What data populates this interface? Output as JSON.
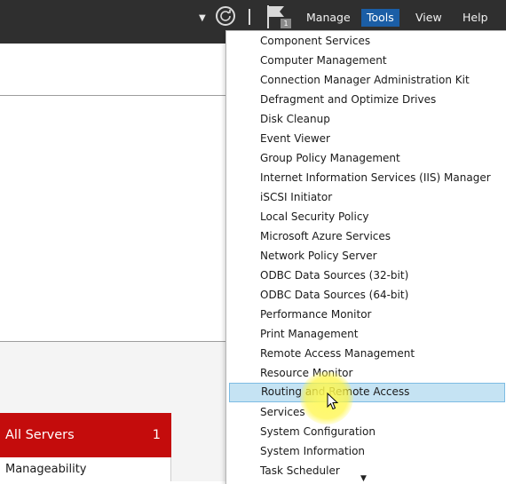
{
  "toolbar": {
    "notification_count": "1",
    "menus": [
      "Manage",
      "Tools",
      "View",
      "Help"
    ],
    "active_menu": "Tools"
  },
  "tools_menu": {
    "items": [
      "Component Services",
      "Computer Management",
      "Connection Manager Administration Kit",
      "Defragment and Optimize Drives",
      "Disk Cleanup",
      "Event Viewer",
      "Group Policy Management",
      "Internet Information Services (IIS) Manager",
      "iSCSI Initiator",
      "Local Security Policy",
      "Microsoft Azure Services",
      "Network Policy Server",
      "ODBC Data Sources (32-bit)",
      "ODBC Data Sources (64-bit)",
      "Performance Monitor",
      "Print Management",
      "Remote Access Management",
      "Resource Monitor",
      "Routing and Remote Access",
      "Services",
      "System Configuration",
      "System Information",
      "Task Scheduler"
    ],
    "highlighted": "Routing and Remote Access"
  },
  "servers": {
    "all_servers_label": "All Servers",
    "all_servers_count": "1",
    "manageability_label": "Manageability"
  },
  "colors": {
    "header_bg": "#2f2f2f",
    "active_menu_bg": "#1b5ea6",
    "all_servers_bg": "#c40c0c",
    "hover_bg": "#c5e3f3"
  }
}
